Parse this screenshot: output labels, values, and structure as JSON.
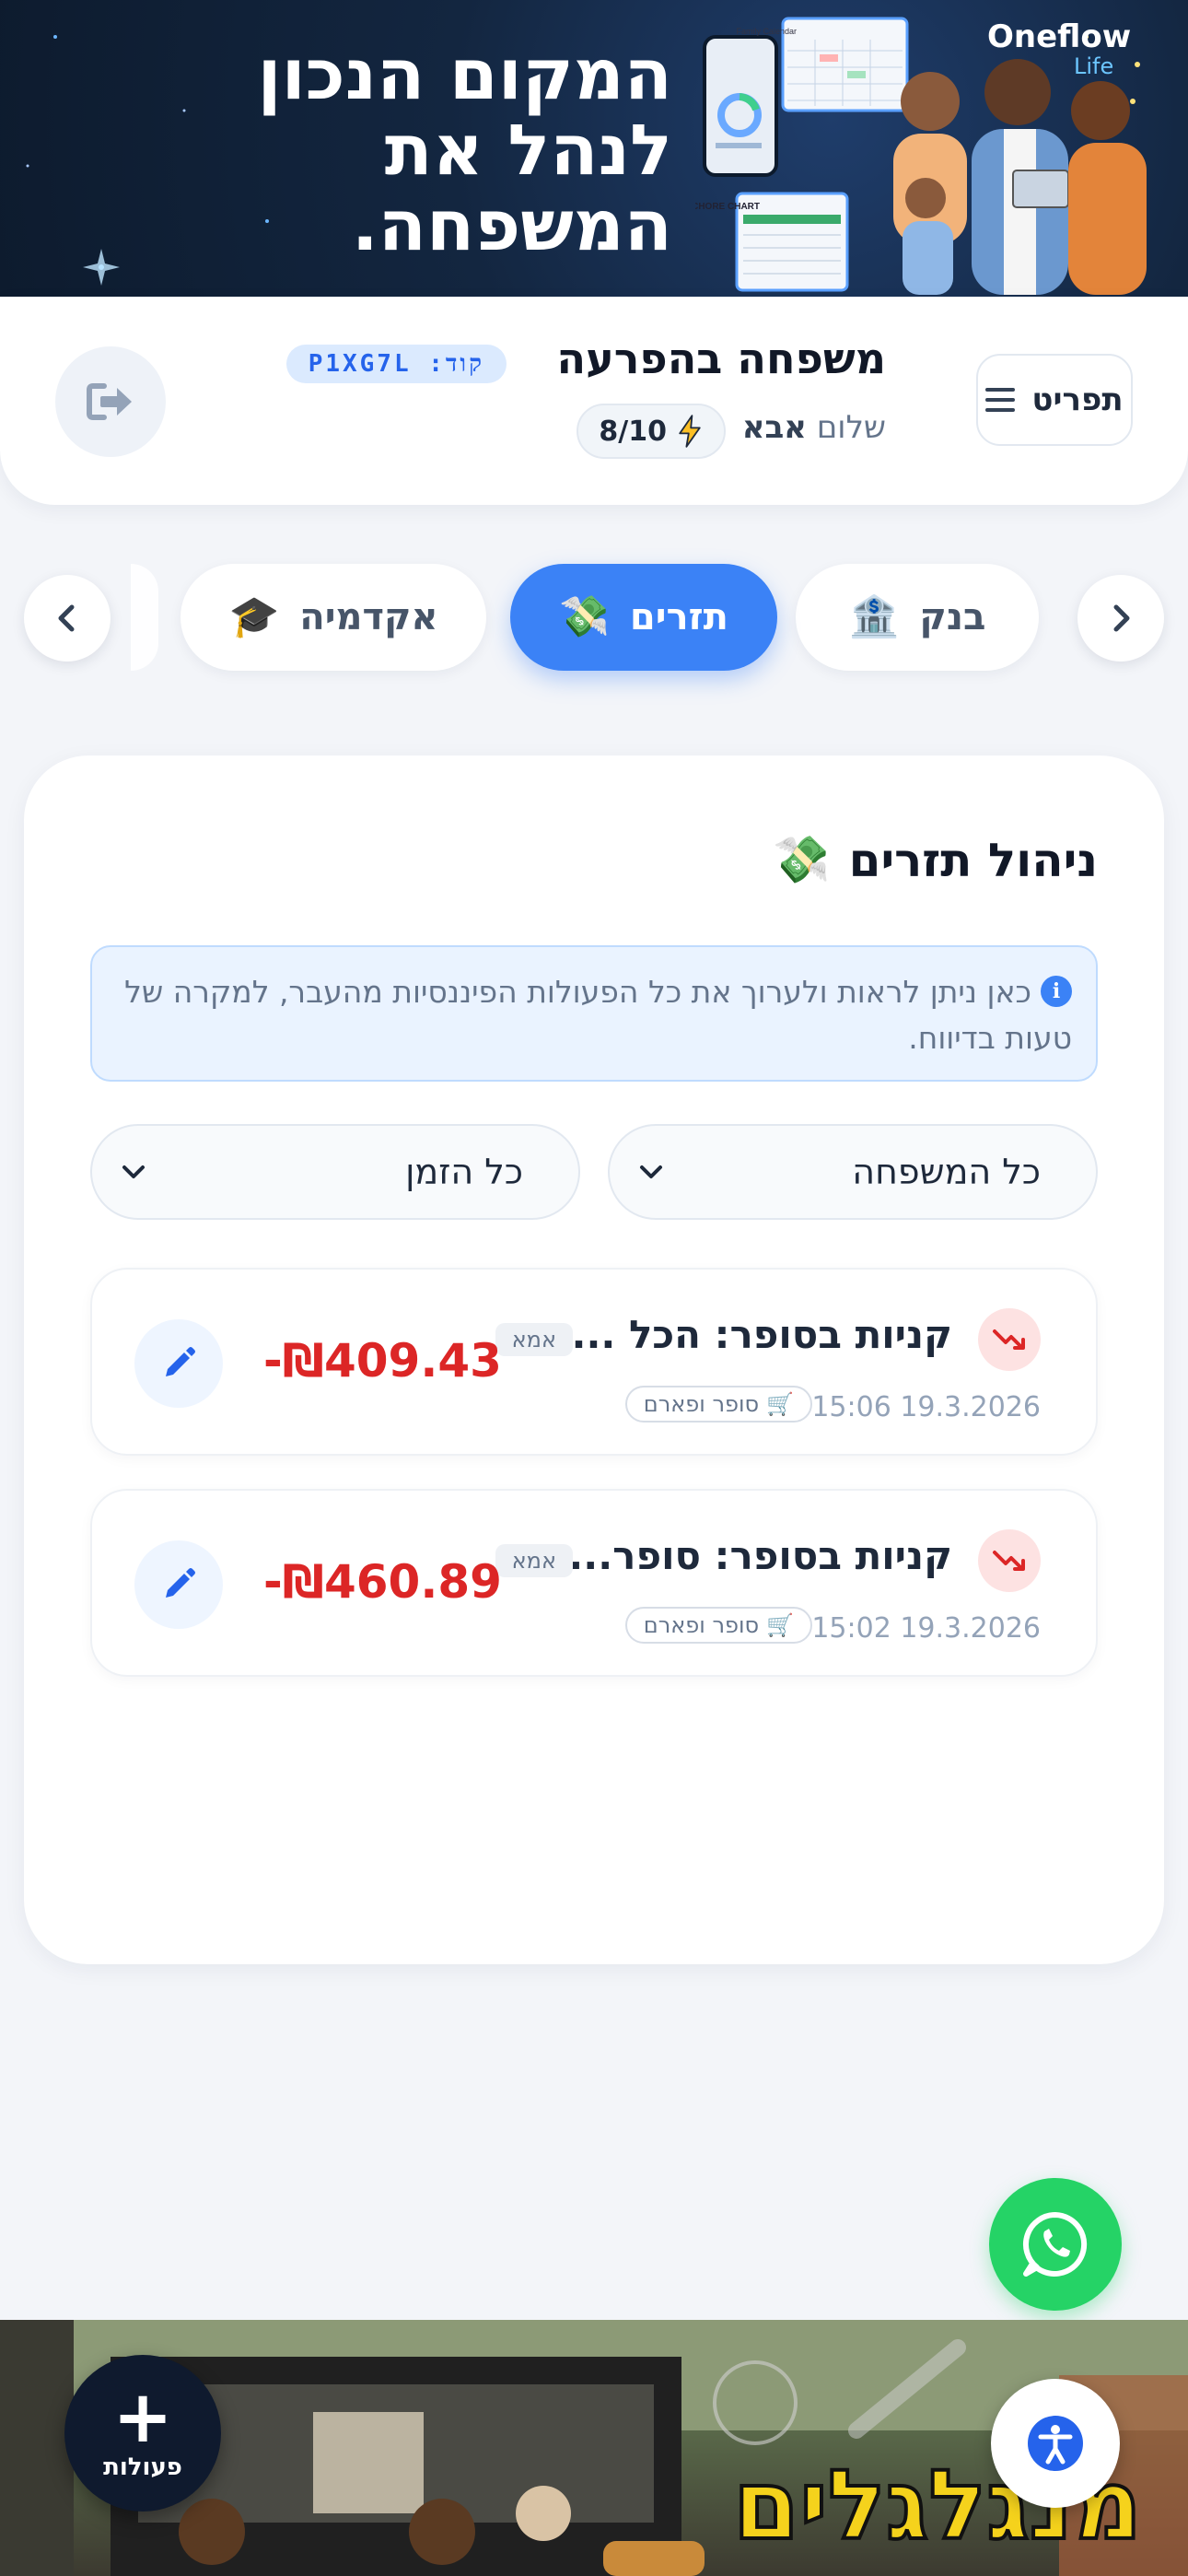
{
  "top_banner": {
    "headline_lines": [
      "המקום הנכון",
      "לנהל את",
      "המשפחה."
    ],
    "brand": "Oneflow",
    "brand_sub": "Life",
    "art_labels": {
      "calendar": "Family Calendar",
      "chart": "CHORE CHART"
    }
  },
  "header": {
    "menu_label": "תפריט",
    "family_name": "משפחה בהפרעה",
    "family_code": "קוד: P1XG7L",
    "greeting_prefix": "שלום",
    "greeting_name": "אבא",
    "energy": "8/10"
  },
  "tabs": [
    {
      "label": "בנק",
      "icon": "bank-icon",
      "emoji": "🏦",
      "active": false
    },
    {
      "label": "תזרים",
      "icon": "money-flow-icon",
      "emoji": "💸",
      "active": true
    },
    {
      "label": "אקדמיה",
      "icon": "graduation-cap-icon",
      "emoji": "🎓",
      "active": false
    }
  ],
  "panel": {
    "title": "ניהול תזרים",
    "title_icon": "💸",
    "info_text": "כאן ניתן לראות ולערוך את כל הפעולות הפיננסיות מהעבר, למקרה של טעות בדיווח.",
    "filters": {
      "member": "כל המשפחה",
      "time": "כל הזמן"
    }
  },
  "transactions": [
    {
      "title": "קניות בסופר: הכל ...",
      "user": "אמא",
      "date": "15:06 19.3.2026",
      "category": "סופר ופארם",
      "category_icon": "🛒",
      "amount": "-₪409.43"
    },
    {
      "title": "קניות בסופר: סופר...",
      "user": "אמא",
      "date": "15:02 19.3.2026",
      "category": "סופר ופארם",
      "category_icon": "🛒",
      "amount": "-₪460.89"
    }
  ],
  "actions_fab": {
    "label": "פעולות"
  },
  "bottom_ad": {
    "brand": "מנגלגלים"
  },
  "colors": {
    "accent": "#3b82f6",
    "negative": "#dc2626",
    "whatsapp": "#25d366",
    "banner_bg": "#132640"
  }
}
